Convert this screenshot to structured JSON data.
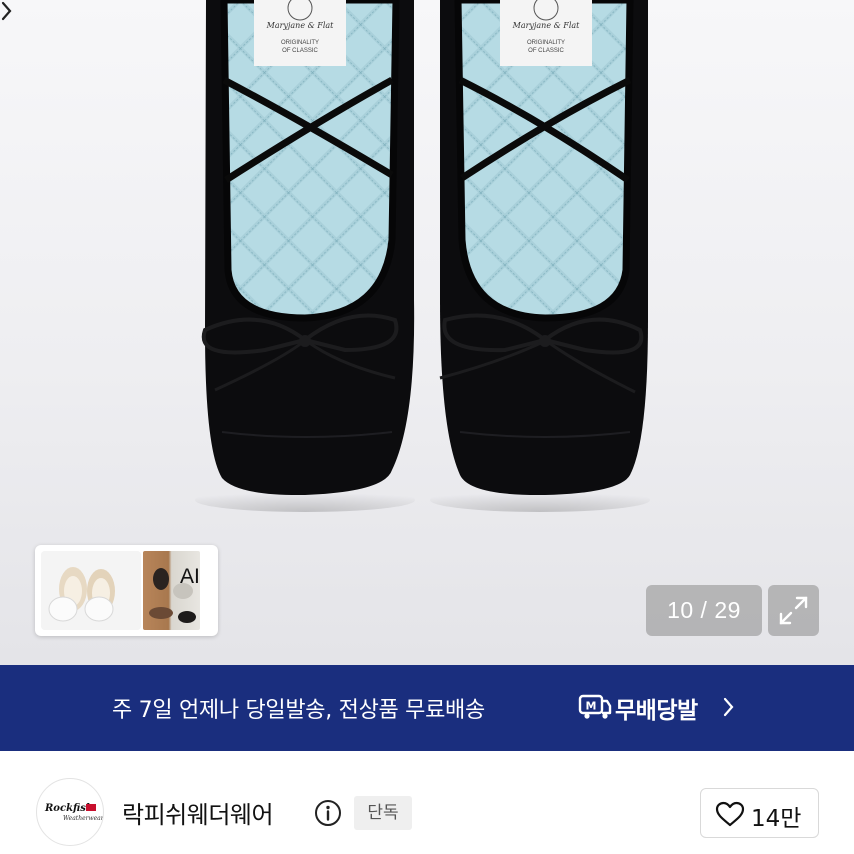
{
  "gallery": {
    "counter": "10 / 29",
    "ai_label": "AI",
    "insole_label_line1": "Maryjane & Flat",
    "insole_label_line2": "ORIGINALITY",
    "insole_label_line3": "OF CLASSIC",
    "icons": {
      "expand": "expand-icon",
      "chevron": "chevron-right-icon"
    }
  },
  "banner": {
    "text": "주 7일 언제나 당일발송, 전상품 무료배송",
    "brand": "무배당발",
    "logo_letter": "M",
    "background": "#1a2e7e"
  },
  "store": {
    "logo_line1": "Rockfish",
    "logo_line2": "Weatherwear",
    "name": "락피쉬웨더웨어",
    "badge": "단독",
    "likes": "14만",
    "icons": {
      "info": "info-icon",
      "heart": "heart-icon"
    }
  }
}
